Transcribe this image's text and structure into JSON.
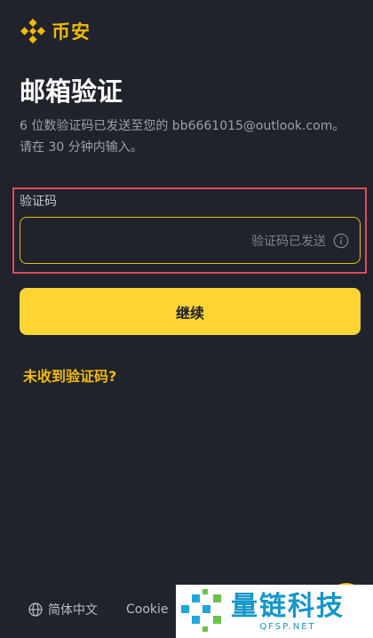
{
  "brand": {
    "name": "币安",
    "accent": "#f0b90b"
  },
  "page": {
    "title": "邮箱验证",
    "description_line1": "6 位数验证码已发送至您的 bb6661015@outlook.com。",
    "description_line2": "请在 30 分钟内输入。"
  },
  "code_field": {
    "label": "验证码",
    "value": "",
    "status": "验证码已发送",
    "status_icon": "info-icon",
    "highlight_color": "#e04a59"
  },
  "continue_button": {
    "label": "继续",
    "color": "#fcd535"
  },
  "resend_link": {
    "label": "未收到验证码?"
  },
  "footer": {
    "language_icon": "globe-icon",
    "language": "简体中文",
    "cookie": "Cookie"
  },
  "watermark": {
    "title": "量链科技",
    "subtitle": "QFSP.NET"
  }
}
